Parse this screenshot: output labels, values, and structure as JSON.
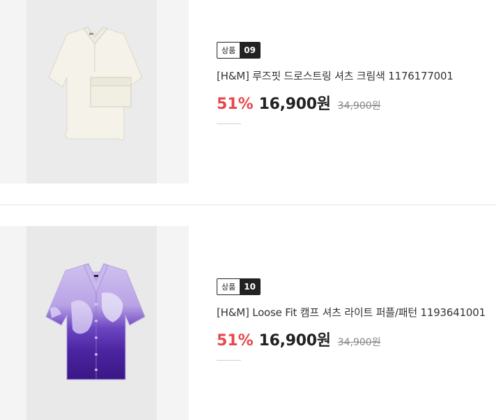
{
  "products": [
    {
      "badge_label": "상품",
      "badge_number": "09",
      "title": "[H&M] 루즈핏 드로스트링 셔츠 크림색 1176177001",
      "discount": "51%",
      "price": "16,900원",
      "original_price": "34,900원",
      "image_colors": [
        "#f2f0e6",
        "#e6e3d6"
      ]
    },
    {
      "badge_label": "상품",
      "badge_number": "10",
      "title": "[H&M] Loose Fit 캠프 셔츠 라이트 퍼플/패턴 1193641001",
      "discount": "51%",
      "price": "16,900원",
      "original_price": "34,900원",
      "image_colors": [
        "#c8b6ec",
        "#3d1c8a"
      ]
    }
  ]
}
